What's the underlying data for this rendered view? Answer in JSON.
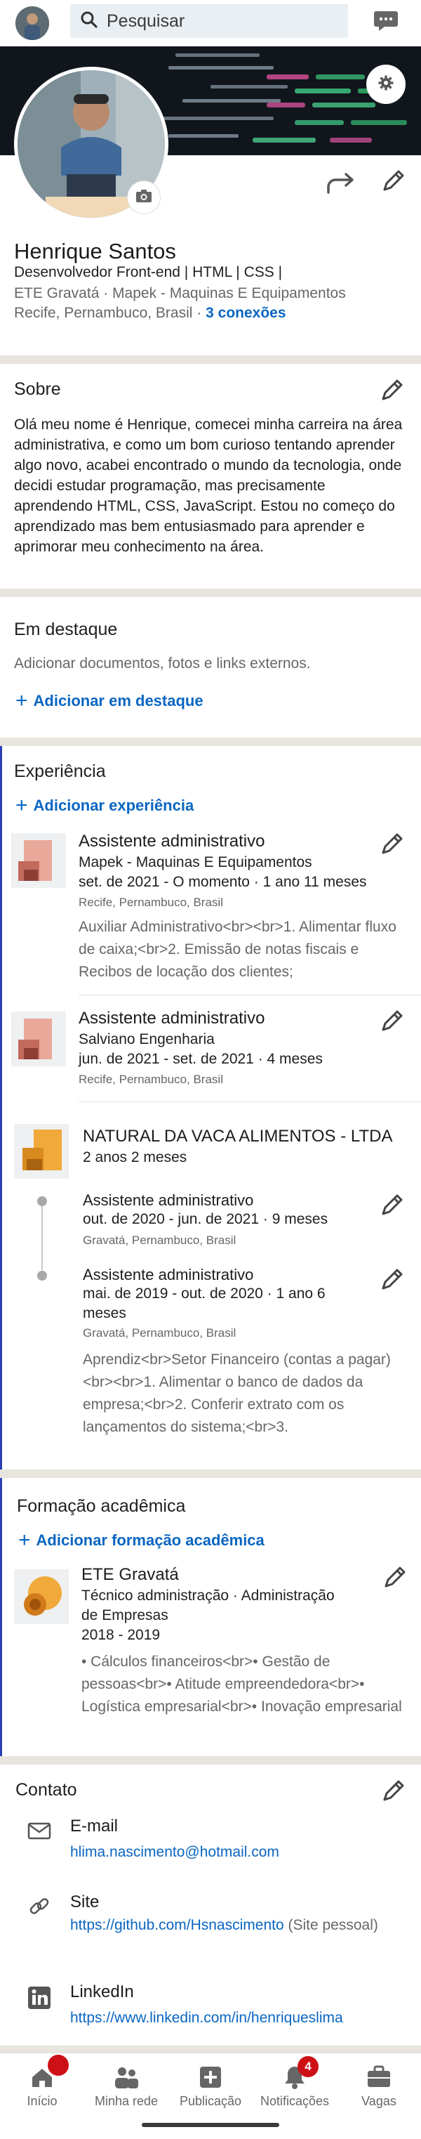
{
  "search": {
    "placeholder": "Pesquisar"
  },
  "profile": {
    "name": "Henrique Santos",
    "headline": "Desenvolvedor Front-end | HTML | CSS |",
    "meta1": "ETE Gravatá  ·  Mapek - Maquinas E Equipamentos",
    "location": "Recife, Pernambuco, Brasil",
    "sep": "·",
    "connections": "3 conexões"
  },
  "about": {
    "title": "Sobre",
    "text": "Olá meu nome é Henrique, comecei minha carreira na área administrativa, e como um bom curioso tentando aprender algo novo, acabei encontrado o mundo da tecnologia, onde decidi estudar programação, mas precisamente aprendendo HTML, CSS, JavaScript. Estou no começo do aprendizado mas bem entusiasmado para aprender e aprimorar meu conhecimento na área."
  },
  "featured": {
    "title": "Em destaque",
    "subtitle": "Adicionar documentos, fotos e links externos.",
    "add_label": "Adicionar em destaque"
  },
  "experience": {
    "title": "Experiência",
    "add_label": "Adicionar experiência",
    "jobs": [
      {
        "title": "Assistente administrativo",
        "company": "Mapek - Maquinas E Equipamentos",
        "dates": "set. de 2021 - O momento  ·  1 ano 11 meses",
        "location": "Recife, Pernambuco, Brasil",
        "description": "Auxiliar Administrativo<br><br>1. Alimentar fluxo de caixa;<br>2. Emissão de notas fiscais e Recibos de locação dos clientes;"
      },
      {
        "title": "Assistente administrativo",
        "company": "Salviano Engenharia",
        "dates": "jun. de 2021 - set. de 2021  ·  4 meses",
        "location": "Recife, Pernambuco, Brasil"
      }
    ],
    "group": {
      "company": "NATURAL DA VACA ALIMENTOS - LTDA",
      "duration": "2 anos 2 meses",
      "roles": [
        {
          "title": "Assistente administrativo",
          "dates": "out. de 2020 - jun. de 2021  ·  9 meses",
          "location": "Gravatá, Pernambuco, Brasil"
        },
        {
          "title": "Assistente administrativo",
          "dates_line1": "mai. de 2019 - out. de 2020  ·  1 ano 6",
          "dates_line2": "meses",
          "location": "Gravatá, Pernambuco, Brasil",
          "description": "Aprendiz<br>Setor Financeiro (contas a pagar)<br><br>1. Alimentar o banco de dados da empresa;<br>2. Conferir extrato com os lançamentos do sistema;<br>3."
        }
      ]
    }
  },
  "education": {
    "title": "Formação acadêmica",
    "add_label": "Adicionar formação acadêmica",
    "school": "ETE Gravatá",
    "degree_line1": "Técnico administração  ·  Administração",
    "degree_line2": "de Empresas",
    "years": "2018 - 2019",
    "description": "• Cálculos financeiros<br>• Gestão de pessoas<br>• Atitude empreendedora<br>• Logística empresarial<br>• Inovação empresarial"
  },
  "contact": {
    "title": "Contato",
    "email_label": "E-mail",
    "email_value": "hlima.nascimento@hotmail.com",
    "site_label": "Site",
    "site_value": "https://github.com/Hsnascimento",
    "site_type": " (Site pessoal)",
    "linkedin_label": "LinkedIn",
    "linkedin_value": "https://www.linkedin.com/in/henriqueslima"
  },
  "nav": {
    "items": [
      {
        "label": "Início",
        "icon": "home-icon"
      },
      {
        "label": "Minha rede",
        "icon": "network-icon"
      },
      {
        "label": "Publicação",
        "icon": "post-icon"
      },
      {
        "label": "Notificações",
        "icon": "bell-icon",
        "badge": "4"
      },
      {
        "label": "Vagas",
        "icon": "briefcase-icon"
      }
    ]
  },
  "colors": {
    "link": "#0a66c2",
    "badge": "#cc1016",
    "accent": "#2a3fb4",
    "separator": "#e8e4de"
  }
}
